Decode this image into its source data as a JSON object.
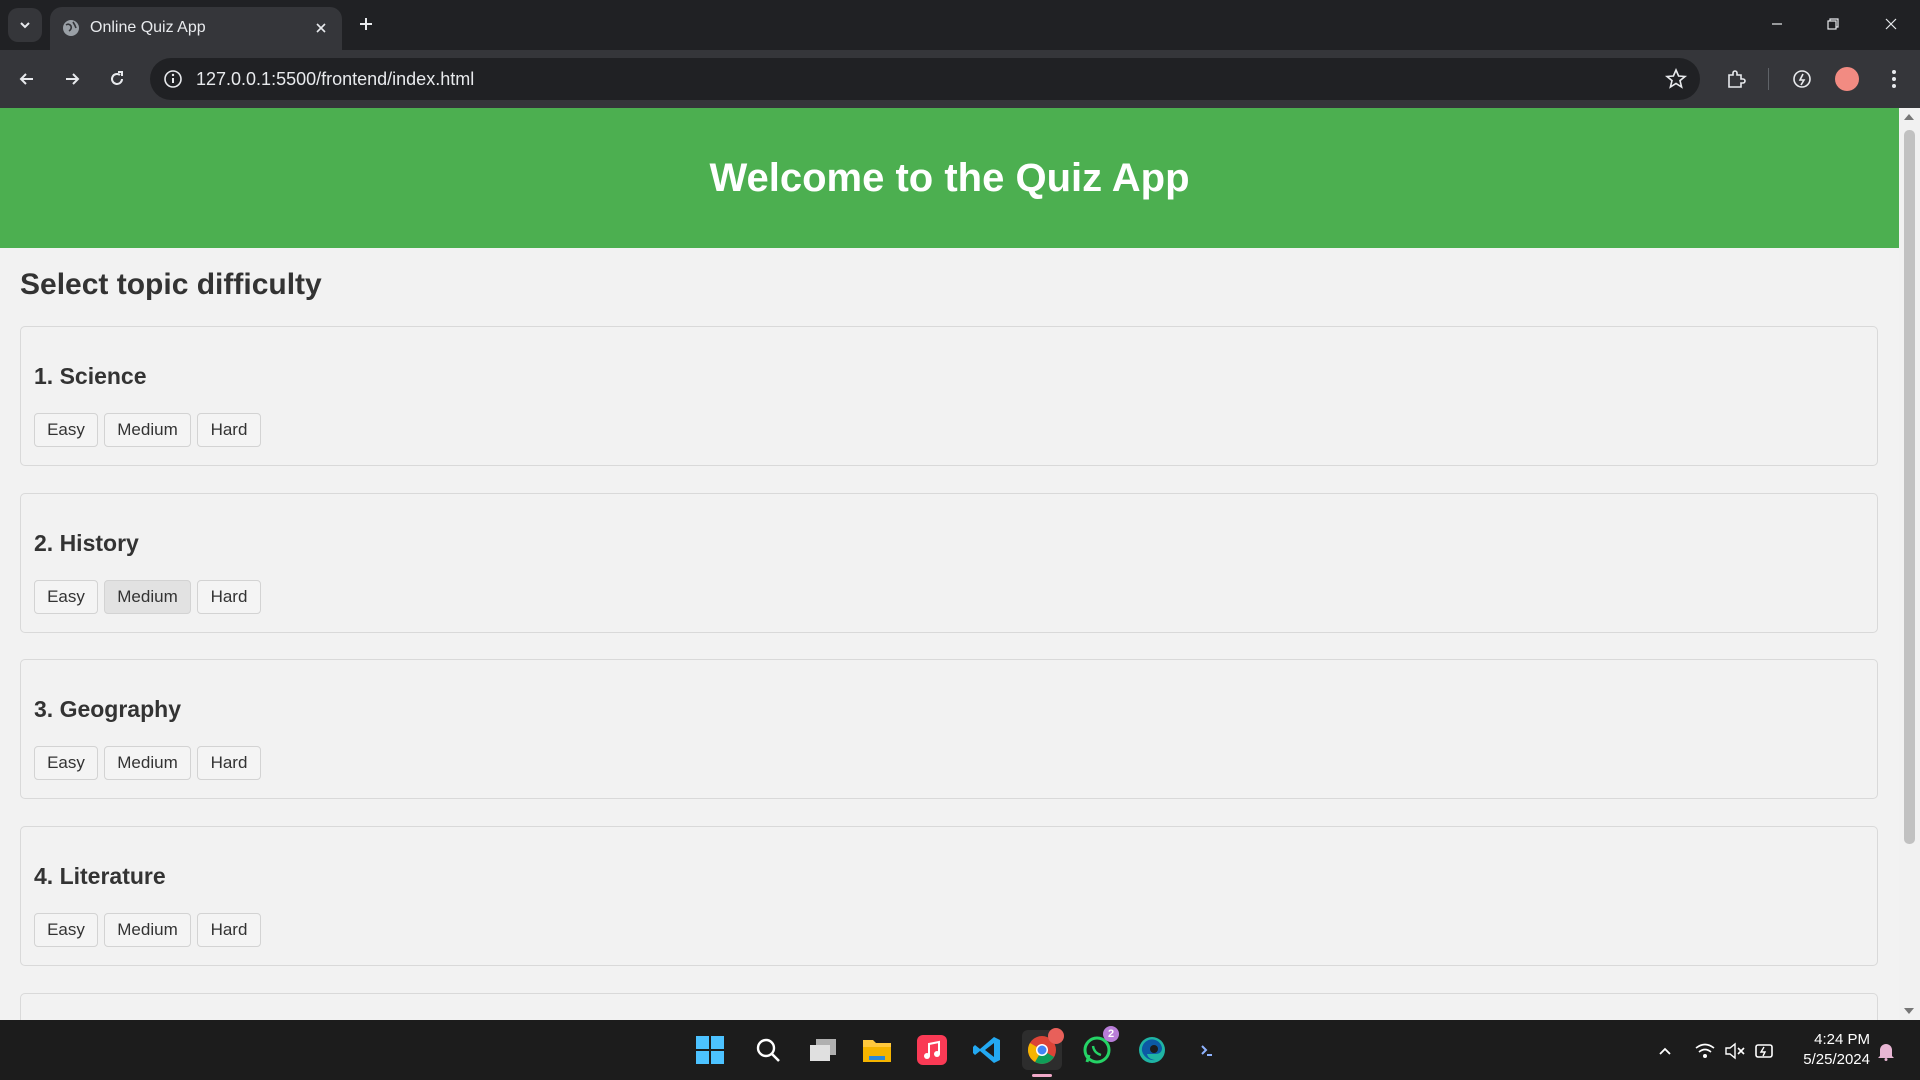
{
  "browser": {
    "tab_title": "Online Quiz App",
    "url": "127.0.0.1:5500/frontend/index.html"
  },
  "page": {
    "header_title": "Welcome to the Quiz App",
    "section_title": "Select topic difficulty",
    "topics": [
      {
        "title": "1. Science",
        "buttons": [
          "Easy",
          "Medium",
          "Hard"
        ]
      },
      {
        "title": "2. History",
        "buttons": [
          "Easy",
          "Medium",
          "Hard"
        ]
      },
      {
        "title": "3. Geography",
        "buttons": [
          "Easy",
          "Medium",
          "Hard"
        ]
      },
      {
        "title": "4. Literature",
        "buttons": [
          "Easy",
          "Medium",
          "Hard"
        ]
      }
    ],
    "header_color": "#4caf50"
  },
  "taskbar": {
    "time": "4:24 PM",
    "date": "5/25/2024",
    "whatsapp_badge": "2"
  }
}
